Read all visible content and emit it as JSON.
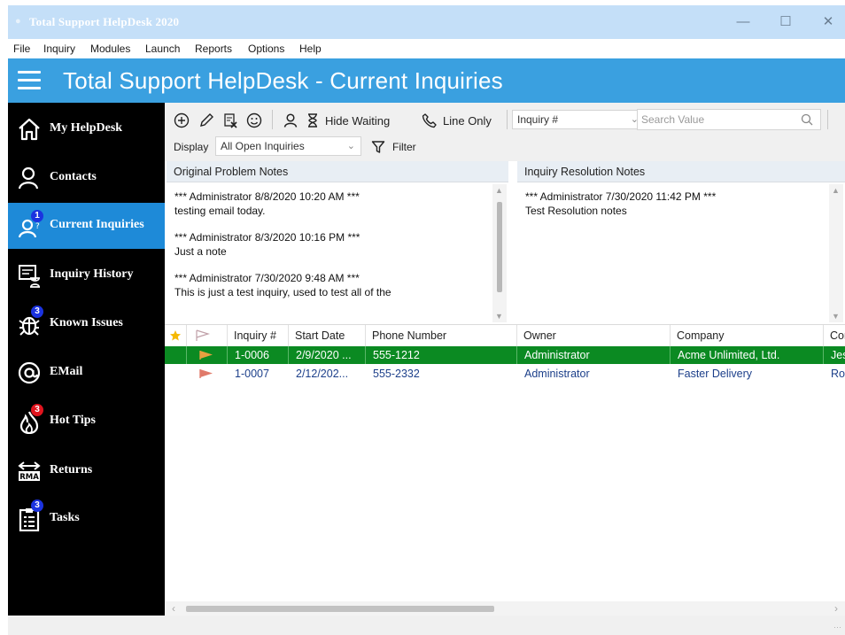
{
  "window": {
    "title": "Total Support HelpDesk 2020",
    "controls": {
      "minimize": "—",
      "maximize": "☐",
      "close": "✕"
    }
  },
  "menu": [
    "File",
    "Inquiry",
    "Modules",
    "Launch",
    "Reports",
    "Options",
    "Help"
  ],
  "header": {
    "title": "Total Support HelpDesk - Current Inquiries"
  },
  "sidebar": {
    "items": [
      {
        "label": "My HelpDesk",
        "icon": "home-icon",
        "badge": ""
      },
      {
        "label": "Contacts",
        "icon": "person-icon",
        "badge": ""
      },
      {
        "label": "Current Inquiries",
        "icon": "inquiry-person-icon",
        "badge": "1",
        "active": true
      },
      {
        "label": "Inquiry History",
        "icon": "history-icon",
        "badge": ""
      },
      {
        "label": "Known Issues",
        "icon": "bug-icon",
        "badge": "3"
      },
      {
        "label": "EMail",
        "icon": "at-icon",
        "badge": ""
      },
      {
        "label": "Hot Tips",
        "icon": "flame-icon",
        "badge": "3"
      },
      {
        "label": "Returns",
        "icon": "rma-icon",
        "badge": ""
      },
      {
        "label": "Tasks",
        "icon": "clipboard-icon",
        "badge": "3"
      }
    ]
  },
  "toolbar": {
    "hide_waiting": "Hide Waiting",
    "line_only": "Line Only",
    "search_field": "Inquiry #",
    "search_placeholder": "Search Value",
    "display_label": "Display",
    "display_value": "All Open Inquiries",
    "filter_label": "Filter"
  },
  "notes": {
    "problem_title": "Original Problem Notes",
    "problem_entries": [
      {
        "header": "*** Administrator 8/8/2020 10:20 AM ***",
        "text": "testing email today."
      },
      {
        "header": "*** Administrator 8/3/2020 10:16 PM ***",
        "text": "Just a note"
      },
      {
        "header": "*** Administrator 7/30/2020 9:48 AM ***",
        "text": "This is just a test inquiry, used to test all of the"
      }
    ],
    "resolution_title": "Inquiry Resolution Notes",
    "resolution_entries": [
      {
        "header": "*** Administrator 7/30/2020 11:42 PM ***",
        "text": "Test Resolution notes"
      }
    ]
  },
  "grid": {
    "columns": [
      "",
      "",
      "Inquiry #",
      "Start Date",
      "Phone Number",
      "Owner",
      "Company",
      "Con"
    ],
    "rows": [
      {
        "inquiry": "1-0006",
        "start_date": "2/9/2020 ...",
        "phone": "555-1212",
        "owner": "Administrator",
        "company": "Acme Unlimited, Ltd.",
        "contact": "Jess",
        "selected": true
      },
      {
        "inquiry": "1-0007",
        "start_date": "2/12/202...",
        "phone": "555-2332",
        "owner": "Administrator",
        "company": "Faster Delivery",
        "contact": "Roa",
        "selected": false
      }
    ]
  },
  "colors": {
    "titlebar": "#c4dff8",
    "header": "#3aa0e0",
    "sidebar": "#000000",
    "active_nav": "#1e8ad8",
    "selected_row": "#0b8a22",
    "badge_blue": "#1b33e0",
    "badge_red": "#e0141e",
    "flag_orange": "#e8a040",
    "flag_salmon": "#e07a6a"
  }
}
